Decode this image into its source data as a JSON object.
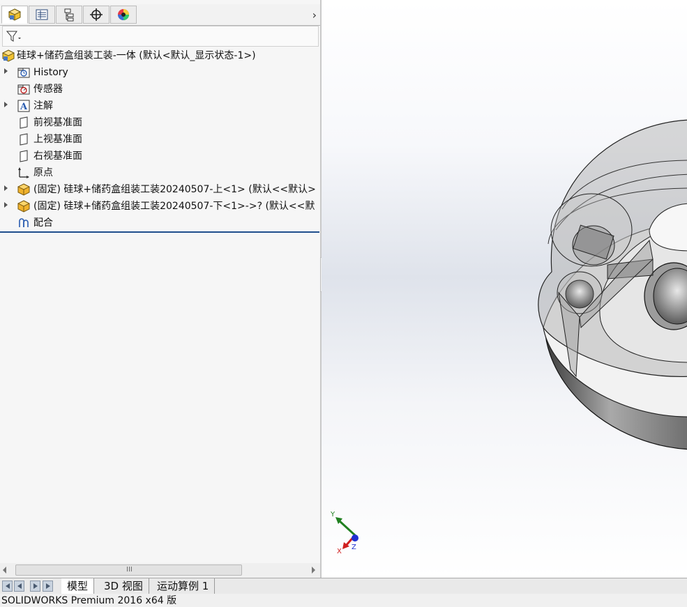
{
  "panel_tabs": [
    {
      "name": "featuremanager",
      "icon": "featuremanager-tree-icon"
    },
    {
      "name": "propertymanager",
      "icon": "propertymanager-icon"
    },
    {
      "name": "configurationmanager",
      "icon": "configurationmanager-icon"
    },
    {
      "name": "dimxpertmanager",
      "icon": "dimxpert-icon"
    },
    {
      "name": "displaymanager",
      "icon": "displaymanager-icon"
    }
  ],
  "tree": {
    "root": "硅球+储药盒组装工装-一体  (默认<默认_显示状态-1>)",
    "items": [
      {
        "label": "History",
        "expandable": true,
        "icon": "history-folder-icon"
      },
      {
        "label": "传感器",
        "expandable": false,
        "icon": "sensor-folder-icon"
      },
      {
        "label": "注解",
        "expandable": true,
        "icon": "annotation-icon"
      },
      {
        "label": "前视基准面",
        "expandable": false,
        "icon": "plane-icon"
      },
      {
        "label": "上视基准面",
        "expandable": false,
        "icon": "plane-icon"
      },
      {
        "label": "右视基准面",
        "expandable": false,
        "icon": "plane-icon"
      },
      {
        "label": "原点",
        "expandable": false,
        "icon": "origin-icon"
      },
      {
        "label": "(固定) 硅球+储药盒组装工装20240507-上<1> (默认<<默认>",
        "expandable": true,
        "icon": "part-icon"
      },
      {
        "label": "(固定) 硅球+储药盒组装工装20240507-下<1>->? (默认<<默",
        "expandable": true,
        "icon": "part-icon"
      },
      {
        "label": "配合",
        "expandable": false,
        "icon": "mates-icon"
      }
    ]
  },
  "bottom_tabs": [
    "模型",
    "3D 视图",
    "运动算例 1"
  ],
  "status": "SOLIDWORKS Premium 2016 x64 版",
  "triad": {
    "x": "X",
    "y": "Y",
    "z": "Z"
  },
  "scrollbar": {
    "grip": "III"
  },
  "colors": {
    "accent": "#1f4e8c",
    "part": "#e0a020",
    "triad_x": "#d02020",
    "triad_y": "#208020",
    "triad_z": "#2030d0"
  }
}
